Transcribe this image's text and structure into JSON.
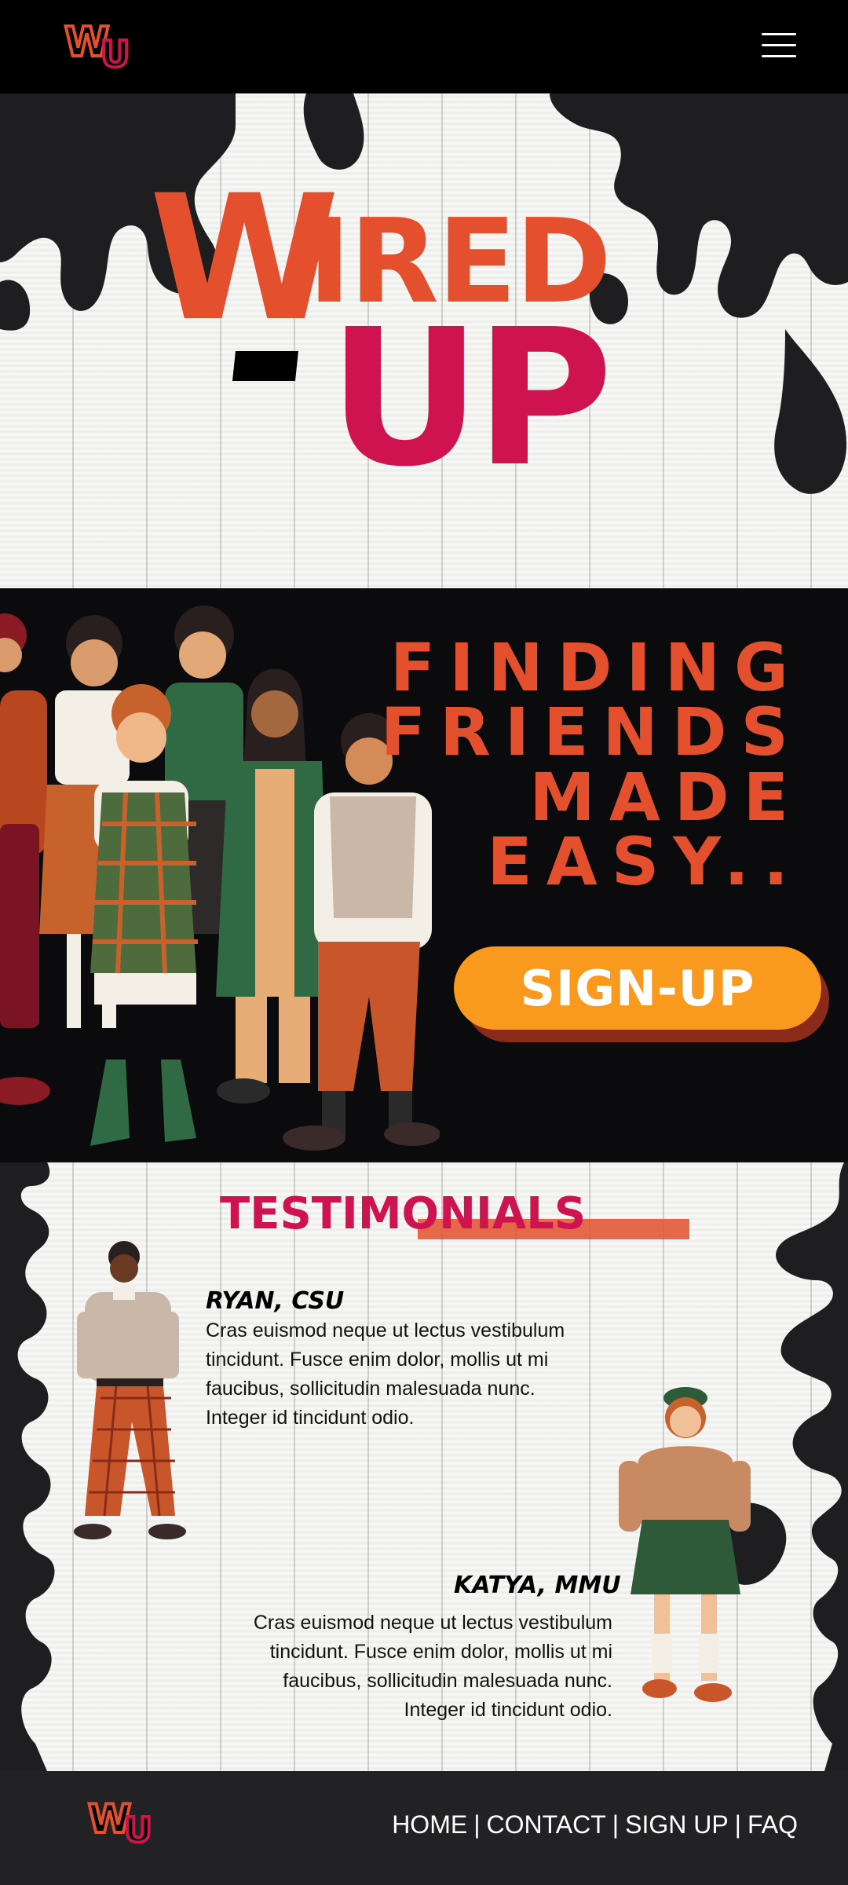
{
  "header": {
    "logo_w": "W",
    "logo_u": "U",
    "menu_icon": "hamburger-menu-icon"
  },
  "hero": {
    "title_w": "W",
    "title_ired": "IRED",
    "title_up": "UP"
  },
  "promo": {
    "tagline": [
      "FINDING",
      "FRIENDS",
      "MADE",
      "EASY.."
    ],
    "signup_label": "SIGN-UP"
  },
  "testimonials": {
    "title": "TESTIMONIALS",
    "items": [
      {
        "name": "RYAN, CSU",
        "lines": [
          "Cras euismod neque ut lectus vestibulum",
          "tincidunt. Fusce enim dolor, mollis ut mi",
          "faucibus, sollicitudin malesuada nunc.",
          "Integer id tincidunt odio."
        ]
      },
      {
        "name": "KATYA, MMU",
        "lines": [
          "Cras euismod neque ut lectus vestibulum",
          "tincidunt. Fusce enim dolor, mollis ut mi",
          "faucibus, sollicitudin malesuada nunc.",
          "Integer id tincidunt odio."
        ]
      }
    ]
  },
  "footer": {
    "logo_w": "W",
    "logo_u": "U",
    "nav": [
      "HOME",
      "CONTACT",
      "SIGN UP",
      "FAQ"
    ],
    "separator": "|"
  },
  "colors": {
    "orange": "#e4502e",
    "crimson": "#cf1351",
    "button": "#f99a1f",
    "dark": "#0b0b0e",
    "footer": "#222224"
  }
}
